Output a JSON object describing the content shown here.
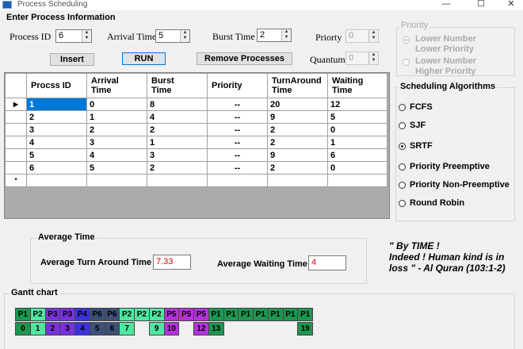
{
  "window": {
    "title": "Process Scheduling",
    "minimize": "—",
    "maximize": "☐",
    "close": "✕"
  },
  "input_group": {
    "title": "Enter Process Information",
    "process_id_label": "Process ID",
    "process_id_value": "6",
    "arrival_label": "Arrival Time",
    "arrival_value": "5",
    "burst_label": "Burst Time",
    "burst_value": "2",
    "priority_label": "Priorty",
    "priority_value": "0",
    "quantum_label": "Quantum",
    "quantum_value": "0",
    "insert_label": "Insert",
    "run_label": "RUN",
    "remove_label": "Remove Processes"
  },
  "priority_group": {
    "title": "Priority",
    "opt1_line1": "Lower Number",
    "opt1_line2": "Lower Priority",
    "opt2_line1": "Lower Number",
    "opt2_line2": "Higher Priority"
  },
  "table": {
    "headers": [
      "Procss ID",
      "Arrival Time",
      "Burst Time",
      "Priority",
      "TurnAround Time",
      "Waiting Time"
    ],
    "header_lines": [
      [
        "Procss ID"
      ],
      [
        "Arrival",
        "Time"
      ],
      [
        "Burst",
        "Time"
      ],
      [
        "Priority"
      ],
      [
        "TurnAround",
        "Time"
      ],
      [
        "Waiting",
        "Time"
      ]
    ],
    "rows": [
      [
        "1",
        "0",
        "8",
        "--",
        "20",
        "12"
      ],
      [
        "2",
        "1",
        "4",
        "--",
        "9",
        "5"
      ],
      [
        "3",
        "2",
        "2",
        "--",
        "2",
        "0"
      ],
      [
        "4",
        "3",
        "1",
        "--",
        "2",
        "1"
      ],
      [
        "5",
        "4",
        "3",
        "--",
        "9",
        "6"
      ],
      [
        "6",
        "5",
        "2",
        "--",
        "2",
        "0"
      ]
    ],
    "current_row_marker": "▶",
    "new_row_marker": "*"
  },
  "algorithms": {
    "title": "Scheduling Algorithms",
    "options": [
      "FCFS",
      "SJF",
      "SRTF",
      "Priority Preemptive",
      "Priority Non-Preemptive",
      "Round Robin"
    ],
    "selected": "SRTF"
  },
  "average": {
    "title": "Average Time",
    "turnaround_label": "Average Turn Around Time",
    "turnaround_value": "7.33",
    "waiting_label": "Average Waiting Time",
    "waiting_value": "4"
  },
  "quote": {
    "line1": "\" By TIME !",
    "line2": "Indeed ! Human kind is in",
    "line3": "loss  \" - Al Quran (103:1-2)"
  },
  "gantt": {
    "title": "Gantt chart",
    "blocks": [
      "P1",
      "P2",
      "P3",
      "P3",
      "P4",
      "P6",
      "P6",
      "P2",
      "P2",
      "P2",
      "P5",
      "P5",
      "P5",
      "P1",
      "P1",
      "P1",
      "P1",
      "P1",
      "P1",
      "P1"
    ],
    "times": [
      "0",
      "1",
      "2",
      "3",
      "4",
      "5",
      "6",
      "7",
      "",
      "9",
      "10",
      "",
      "12",
      "13",
      "",
      "",
      "",
      "",
      "",
      "19"
    ],
    "colors": {
      "P1": "#1e9650",
      "P2": "#50e6a0",
      "P3": "#7832dc",
      "P4": "#3c32dc",
      "P5": "#b432dc",
      "P6": "#3c5078"
    }
  }
}
